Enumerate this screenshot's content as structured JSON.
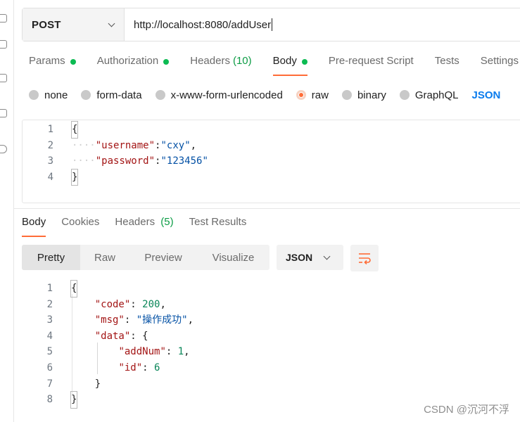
{
  "request": {
    "method": "POST",
    "url": "http://localhost:8080/addUser",
    "tabs": [
      {
        "label": "Params",
        "dot": true
      },
      {
        "label": "Authorization",
        "dot": true
      },
      {
        "label": "Headers",
        "count": "(10)"
      },
      {
        "label": "Body",
        "dot": true,
        "active": true
      },
      {
        "label": "Pre-request Script"
      },
      {
        "label": "Tests"
      },
      {
        "label": "Settings"
      }
    ],
    "body_types": [
      "none",
      "form-data",
      "x-www-form-urlencoded",
      "raw",
      "binary",
      "GraphQL"
    ],
    "body_type_selected": "raw",
    "body_format": "JSON",
    "body_lines": [
      "1",
      "2",
      "3",
      "4"
    ]
  },
  "response": {
    "tabs": [
      {
        "label": "Body",
        "active": true
      },
      {
        "label": "Cookies"
      },
      {
        "label": "Headers",
        "count": "(5)"
      },
      {
        "label": "Test Results"
      }
    ],
    "views": [
      "Pretty",
      "Raw",
      "Preview",
      "Visualize"
    ],
    "view_selected": "Pretty",
    "format": "JSON",
    "lines": [
      "1",
      "2",
      "3",
      "4",
      "5",
      "6",
      "7",
      "8"
    ],
    "code": {
      "value": 200
    },
    "msg": "操作成功",
    "data": {
      "addNum": 1,
      "id": 6
    }
  },
  "request_body": {
    "username": "cxy",
    "password": "123456"
  },
  "watermark": "CSDN @沉河不浮",
  "colors": {
    "accent": "#ff6c37",
    "dot_green": "#0cbb52",
    "json_blue": "#097bed"
  },
  "icons": {
    "method_dropdown": "chevron-down-icon",
    "wrap": "wrap-lines-icon"
  }
}
